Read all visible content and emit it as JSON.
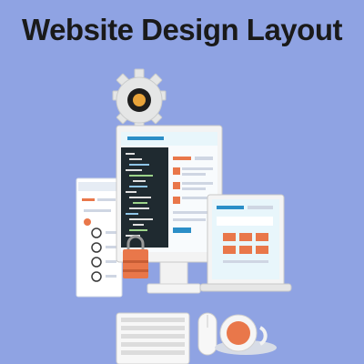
{
  "header": {
    "title": "Website Design Layout"
  },
  "icons": {
    "gear": "gear-icon",
    "lock": "padlock-icon",
    "mouse": "mouse-icon",
    "coffee": "coffee-cup-icon",
    "keyboard": "keyboard-icon"
  },
  "colors": {
    "background": "#8fa3e3",
    "accent_orange": "#e9774a",
    "accent_blue": "#2b8ec7",
    "screen_dark": "#1f2a30",
    "gear_gray": "#e5e6e6"
  }
}
